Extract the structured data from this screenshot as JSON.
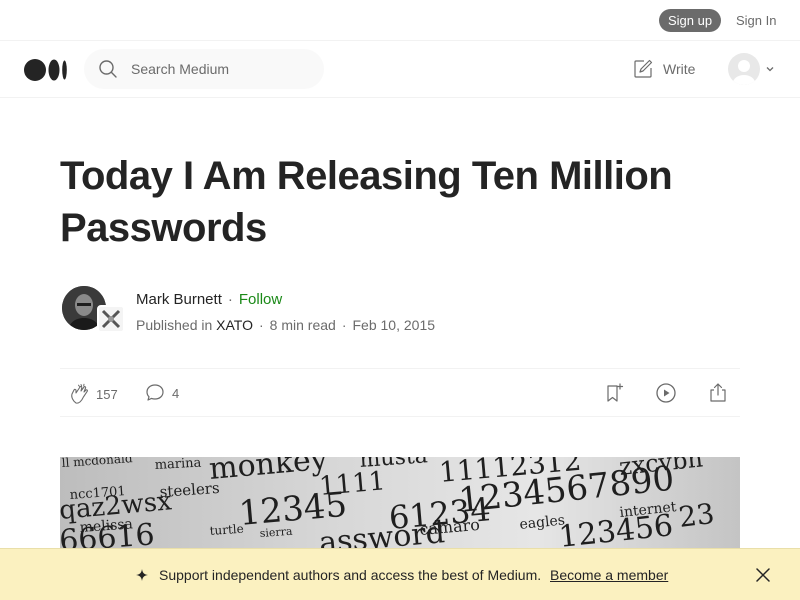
{
  "topbar": {
    "signup_label": "Sign up",
    "signin_label": "Sign In"
  },
  "nav": {
    "logo_icon": "medium-logo-icon",
    "search": {
      "icon": "search-icon",
      "placeholder": "Search Medium",
      "value": ""
    },
    "write_label": "Write",
    "write_icon": "write-icon",
    "avatar_icon": "avatar-icon",
    "chevron_icon": "chevron-down-icon"
  },
  "article": {
    "title": "Today I Am Releasing Ten Million Passwords",
    "author": {
      "name": "Mark Burnett",
      "separator": "·",
      "follow_label": "Follow"
    },
    "meta": {
      "published_in_prefix": "Published in",
      "publication": "XATO",
      "separator": "·",
      "read_time": "8 min read",
      "date": "Feb 10, 2015"
    },
    "actions": {
      "clap_count": "157",
      "response_count": "4",
      "icons": [
        "clap-icon",
        "response-icon",
        "bookmark-icon",
        "play-icon",
        "share-icon"
      ]
    }
  },
  "banner": {
    "text": "Support independent authors and access the best of Medium.",
    "link_label": "Become a member",
    "icon": "sparkle-icon",
    "close_icon": "close-icon"
  },
  "colors": {
    "text": "#242424",
    "muted": "#6b6b6b",
    "follow_green": "#1a8917",
    "banner_bg": "#fbf1c0",
    "signup_bg": "#6b6b6b"
  }
}
